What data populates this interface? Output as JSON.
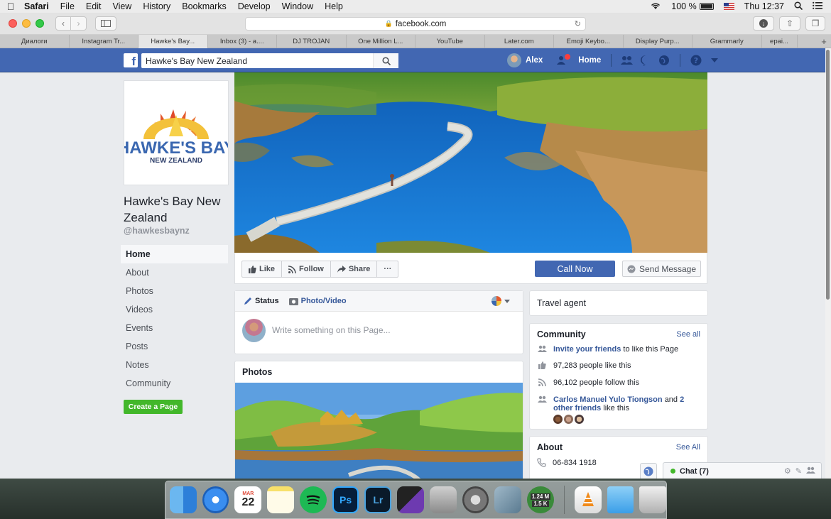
{
  "menubar": {
    "app": "Safari",
    "items": [
      "File",
      "Edit",
      "View",
      "History",
      "Bookmarks",
      "Develop",
      "Window",
      "Help"
    ],
    "battery": "100 %",
    "clock": "Thu 12:37"
  },
  "browser": {
    "url": "facebook.com",
    "tabs": [
      "Диалоги",
      "Instagram Tr...",
      "Hawke's Bay...",
      "Inbox (3) - a....",
      "DJ TROJAN",
      "One Million L...",
      "YouTube",
      "Later.com",
      "Emoji Keybo...",
      "Display Purp...",
      "Grammarly",
      "epai..."
    ],
    "active_tab_index": 2
  },
  "fb": {
    "search_value": "Hawke's Bay New Zealand",
    "user_name": "Alex",
    "home_label": "Home"
  },
  "page": {
    "logo_line1": "HAWKE'S BAY",
    "logo_line2": "NEW ZEALAND",
    "name": "Hawke's Bay New Zealand",
    "handle": "@hawkesbaynz",
    "nav": [
      "Home",
      "About",
      "Photos",
      "Videos",
      "Events",
      "Posts",
      "Notes",
      "Community"
    ],
    "create_page": "Create a Page"
  },
  "actions": {
    "like": "Like",
    "follow": "Follow",
    "share": "Share",
    "more": "···",
    "call_now": "Call Now",
    "send_message": "Send Message"
  },
  "composer": {
    "status": "Status",
    "photo_video": "Photo/Video",
    "placeholder": "Write something on this Page..."
  },
  "photos": {
    "title": "Photos"
  },
  "sidebar": {
    "category": "Travel agent",
    "community": {
      "title": "Community",
      "see_all": "See all",
      "invite_link": "Invite your friends",
      "invite_rest": "to like this Page",
      "likes": "97,283 people like this",
      "follows": "96,102 people follow this",
      "friends_link": "Carlos Manuel Yulo Tiongson",
      "friends_and": "and",
      "friends_other": "2 other friends",
      "friends_rest": "like this"
    },
    "about": {
      "title": "About",
      "see_all": "See All",
      "phone": "06-834 1918"
    }
  },
  "chat": {
    "label": "Chat (7)"
  },
  "dock": {
    "calendar_month": "MAR",
    "calendar_day": "22",
    "ps": "Ps",
    "lr": "Lr",
    "meter_up": "1.24 M",
    "meter_down": "1.5 K"
  },
  "colors": {
    "fb_blue": "#4267b2",
    "link_blue": "#365899",
    "green": "#42b72a"
  }
}
